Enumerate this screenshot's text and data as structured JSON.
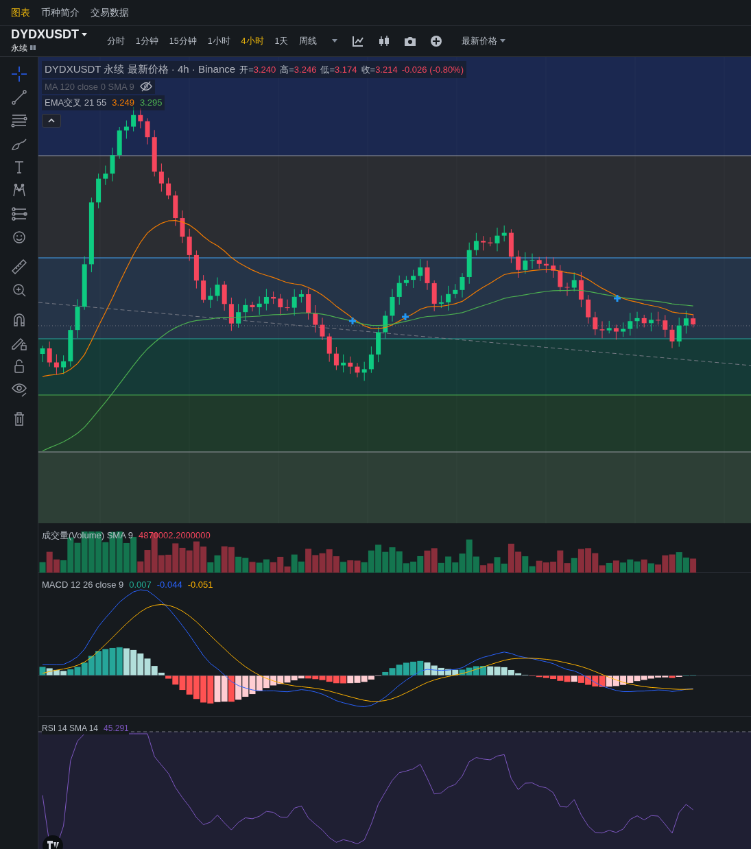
{
  "tabs": [
    {
      "label": "图表",
      "selected": true
    },
    {
      "label": "币种简介",
      "selected": false
    },
    {
      "label": "交易数据",
      "selected": false
    }
  ],
  "symbol": {
    "name": "DYDXUSDT",
    "type": "永续"
  },
  "intervals": [
    {
      "label": "分时",
      "selected": false
    },
    {
      "label": "1分钟",
      "selected": false
    },
    {
      "label": "15分钟",
      "selected": false
    },
    {
      "label": "1小时",
      "selected": false
    },
    {
      "label": "4小时",
      "selected": true
    },
    {
      "label": "1天",
      "selected": false
    },
    {
      "label": "周线",
      "selected": false
    }
  ],
  "price_type": "最新价格",
  "legend": {
    "title": "DYDXUSDT 永续 最新价格 · 4h · Binance",
    "ohlc": [
      {
        "label": "开=",
        "value": "3.240"
      },
      {
        "label": "高=",
        "value": "3.246"
      },
      {
        "label": "低=",
        "value": "3.174"
      },
      {
        "label": "收=",
        "value": "3.214"
      }
    ],
    "change": "-0.026 (-0.80%)"
  },
  "indicators": [
    {
      "label": "MA 120 close 0 SMA 9",
      "hidden": true
    },
    {
      "label": "EMA交叉 21 55",
      "hidden": false,
      "values": [
        {
          "text": "3.249",
          "color": "#f57c00"
        },
        {
          "text": "3.295",
          "color": "#4caf50"
        }
      ]
    }
  ],
  "volume": {
    "label": "成交量(Volume) SMA 9",
    "value": "4870002.2000000"
  },
  "macd": {
    "label": "MACD 12 26 close 9",
    "values": [
      {
        "text": "0.007",
        "color": "#22ab94"
      },
      {
        "text": "-0.044",
        "color": "#2962ff"
      },
      {
        "text": "-0.051",
        "color": "#ffb300"
      }
    ]
  },
  "rsi": {
    "label": "RSI 14 SMA 14",
    "value": "45.291"
  }
}
